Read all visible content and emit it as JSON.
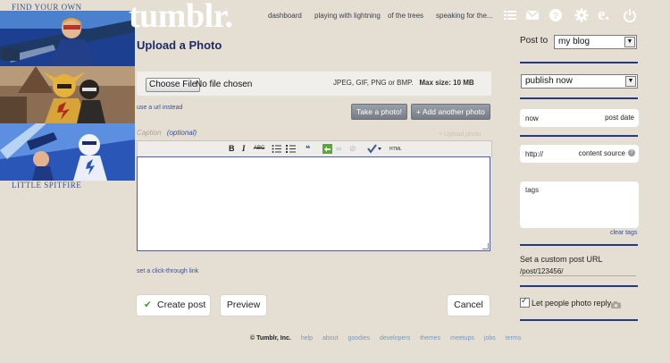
{
  "side_art": {
    "top_caption": "FIND YOUR OWN",
    "bottom_caption": "LITTLE SPITFIRE"
  },
  "header": {
    "logo": "tumblr.",
    "nav": [
      "dashboard",
      "playing with lightning",
      "of the trees",
      "speaking for the..."
    ],
    "icons": [
      "dashboard-list-icon",
      "mail-icon",
      "help-icon",
      "settings-gear-icon",
      "edit-e-icon",
      "power-icon"
    ]
  },
  "main": {
    "title": "Upload a Photo",
    "file_button": "Choose File",
    "file_status": "No file chosen",
    "file_hint": "JPEG, GIF, PNG or BMP.",
    "max_size": "Max size: 10 MB",
    "use_url": "use a url instead",
    "take_photo": "Take a photo!",
    "add_another": "+ Add another photo",
    "caption_label": "Caption",
    "caption_optional": "(optional)",
    "upload_photo": "+ Upload photo",
    "toolbar": {
      "bold": "B",
      "italic": "I",
      "strike": "ABC",
      "ul": "bulleted-list-icon",
      "ol": "numbered-list-icon",
      "quote": "quote-icon",
      "image": "insert-image-icon",
      "link": "link-icon",
      "unlink": "unlink-icon",
      "spell": "spellcheck-icon",
      "html": "HTML"
    },
    "click_through": "set a click-through link",
    "create_post": "Create post",
    "preview": "Preview",
    "cancel": "Cancel"
  },
  "right": {
    "post_to_label": "Post to",
    "post_to_value": "my blog",
    "publish_value": "publish now",
    "date_value": "now",
    "date_label": "post date",
    "source_value": "http://",
    "source_label": "content source",
    "tags_placeholder": "tags",
    "clear_tags": "clear tags",
    "custom_url_label": "Set a custom post URL",
    "custom_url_value": "/post/123456/",
    "photo_reply_label": "Let people photo reply",
    "photo_reply_checked": true
  },
  "footer": {
    "copyright": "© Tumblr, Inc.",
    "links": [
      "help",
      "about",
      "goodies",
      "developers",
      "themes",
      "meetups",
      "jobs",
      "terms"
    ]
  },
  "colors": {
    "background": "#e5ded2",
    "accent_navy": "#243a85",
    "link_blue": "#36509a",
    "logo_white": "#ffffff"
  }
}
